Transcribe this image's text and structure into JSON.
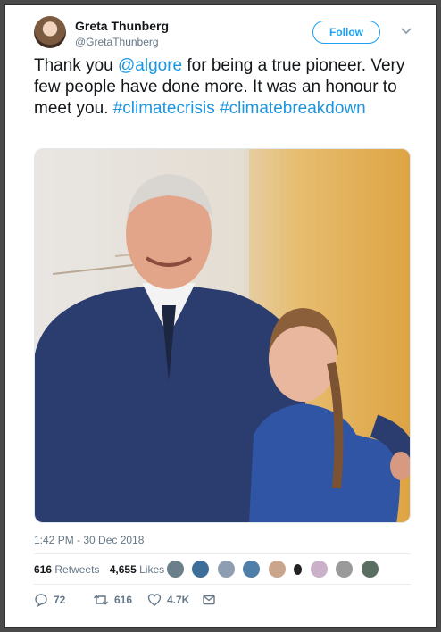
{
  "user": {
    "name": "Greta Thunberg",
    "handle": "@GretaThunberg",
    "follow_label": "Follow"
  },
  "tweet": {
    "text_before": "Thank you ",
    "mention": "@algore",
    "text_middle": " for being a true pioneer. Very few people have done more. It was an honour to meet you. ",
    "hashtag1": "#climatecrisis",
    "hashtag2": "#climatebreakdown"
  },
  "timestamp": "1:42 PM - 30 Dec 2018",
  "stats": {
    "retweets_count": "616",
    "retweets_label": "Retweets",
    "likes_count": "4,655",
    "likes_label": "Likes"
  },
  "likers_icons": [
    "liker-avatar-icon",
    "liker-avatar-icon",
    "liker-avatar-icon",
    "liker-avatar-icon",
    "liker-avatar-icon",
    "liker-avatar-icon",
    "liker-avatar-icon",
    "liker-avatar-icon",
    "liker-avatar-icon"
  ],
  "actions": {
    "reply_count": "72",
    "retweet_count": "616",
    "like_count": "4.7K"
  },
  "colors": {
    "accent": "#1da1f2",
    "link": "#1b95e0",
    "text": "#14171a",
    "muted": "#657786"
  }
}
